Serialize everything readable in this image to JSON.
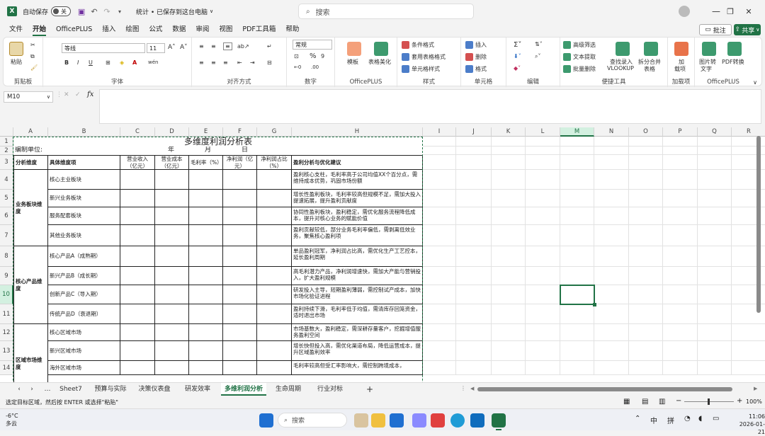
{
  "titlebar": {
    "autosave_label": "自动保存",
    "autosave_state": "关",
    "doc_title": "统计 • 已保存到这台电脑",
    "search_placeholder": "搜索"
  },
  "menu": [
    "文件",
    "开始",
    "OfficePLUS",
    "插入",
    "绘图",
    "公式",
    "数据",
    "审阅",
    "视图",
    "PDF工具箱",
    "帮助"
  ],
  "menu_active": "开始",
  "notes_label": "批注",
  "share_label": "共享",
  "ribbon": {
    "clipboard": {
      "paste": "粘贴",
      "label": "剪贴板"
    },
    "font": {
      "name": "等线",
      "size": "11",
      "label": "字体"
    },
    "alignment": {
      "label": "对齐方式"
    },
    "number": {
      "format": "常规",
      "label": "数字"
    },
    "officeplus": {
      "template": "模板",
      "beautify": "表格美化",
      "label": "OfficePLUS"
    },
    "styles": {
      "conditional": "条件格式",
      "table": "套用表格格式",
      "cell": "单元格样式",
      "label": "样式"
    },
    "cells": {
      "insert": "插入",
      "delete": "删除",
      "format": "格式",
      "label": "单元格"
    },
    "editing": {
      "label": "编辑"
    },
    "convenience": {
      "adv_filter": "高级筛选",
      "text_extract": "文本提取",
      "batch_delete": "批量删除",
      "vlookup1": "查找录入",
      "vlookup2": "VLOOKUP",
      "split1": "拆分合并",
      "split2": "表格",
      "label": "便捷工具"
    },
    "addins": {
      "add1": "加",
      "add2": "载项",
      "label": "加载项"
    },
    "officeplus2": {
      "img1": "图片转",
      "img2": "文字",
      "pdf1": "PDF转换",
      "label": "OfficePLUS"
    }
  },
  "namebox": "M10",
  "fx": "fx",
  "columns": [
    "A",
    "B",
    "C",
    "D",
    "E",
    "F",
    "G",
    "H",
    "I",
    "J",
    "K",
    "L",
    "M",
    "N",
    "O",
    "P",
    "Q",
    "R"
  ],
  "rows": [
    "1",
    "2",
    "3",
    "4",
    "5",
    "6",
    "7",
    "8",
    "9",
    "10",
    "11",
    "12",
    "13",
    "14"
  ],
  "sheet": {
    "title": "多维度利润分析表",
    "compiler": "编制单位:",
    "date_y": "年",
    "date_m": "月",
    "date_d": "日",
    "headers": [
      "分析维度",
      "具体维度项",
      "营业收入（亿元）",
      "营业成本（亿元）",
      "毛利率（%）",
      "净利润（亿元）",
      "净利润占比（%）",
      "盈利分析与优化建议"
    ],
    "groups": [
      {
        "name": "业务板块维度",
        "items": [
          {
            "item": "核心主业板块",
            "note": "盈利核心支柱，毛利率高于公司均值XX个百分点，需维持成本优势，巩固市场份额"
          },
          {
            "item": "新兴业务板块",
            "note": "增长性盈利板块，毛利率较高但规模不足，需加大投入提速拓展，提升盈利贡献度"
          },
          {
            "item": "服务配套板块",
            "note": "协同性盈利板块，盈利稳定，需优化服务流程降低成本，提升对核心业务的赋能价值"
          },
          {
            "item": "其他业务板块",
            "note": "盈利贡献较低，部分业务毛利率偏低，需剥离低效业务，聚焦核心盈利项"
          }
        ]
      },
      {
        "name": "核心产品维度",
        "items": [
          {
            "item": "核心产品A（成熟期）",
            "note": "单品盈利冠军，净利润占比高，需优化生产工艺控本，延长盈利周期"
          },
          {
            "item": "新兴产品B（成长期）",
            "note": "高毛利潜力产品，净利润增速快，需加大产能与营销投入，扩大盈利规模"
          },
          {
            "item": "创新产品C（导入期）",
            "note": "研发投入主导，短期盈利薄弱，需控制试产成本，加快市场化验证进程"
          },
          {
            "item": "传统产品D（衰退期）",
            "note": "盈利持续下滑，毛利率低于均值，需清库存回笼资金，适时退出市场"
          }
        ]
      },
      {
        "name": "区域市场维度",
        "items": [
          {
            "item": "核心区域市场",
            "note": "市场基数大，盈利稳定，需深耕存量客户，挖掘增值服务盈利空间"
          },
          {
            "item": "新兴区域市场",
            "note": "增长快但投入高，需优化渠道布局，降低运营成本，提升区域盈利效率"
          },
          {
            "item": "海外区域市场",
            "note": "毛利率较高但受汇率影响大，需控制跨境成本，"
          }
        ]
      }
    ]
  },
  "tabs": [
    "Sheet7",
    "预算与实际",
    "决策仪表盘",
    "研发效率",
    "多维利润分析",
    "生命周期",
    "行业对标"
  ],
  "tab_active": "多维利润分析",
  "status": {
    "message": "选定目标区域，然后按 ENTER 或选择\"粘贴\"",
    "zoom": "100%"
  },
  "taskbar": {
    "weather_temp": "-6°C",
    "weather_desc": "多云",
    "search": "搜索",
    "time": "11:06",
    "date": "2026-01-21",
    "ime1": "中",
    "ime2": "拼"
  },
  "colors": {
    "accent": "#217346",
    "selection": "#217346"
  }
}
